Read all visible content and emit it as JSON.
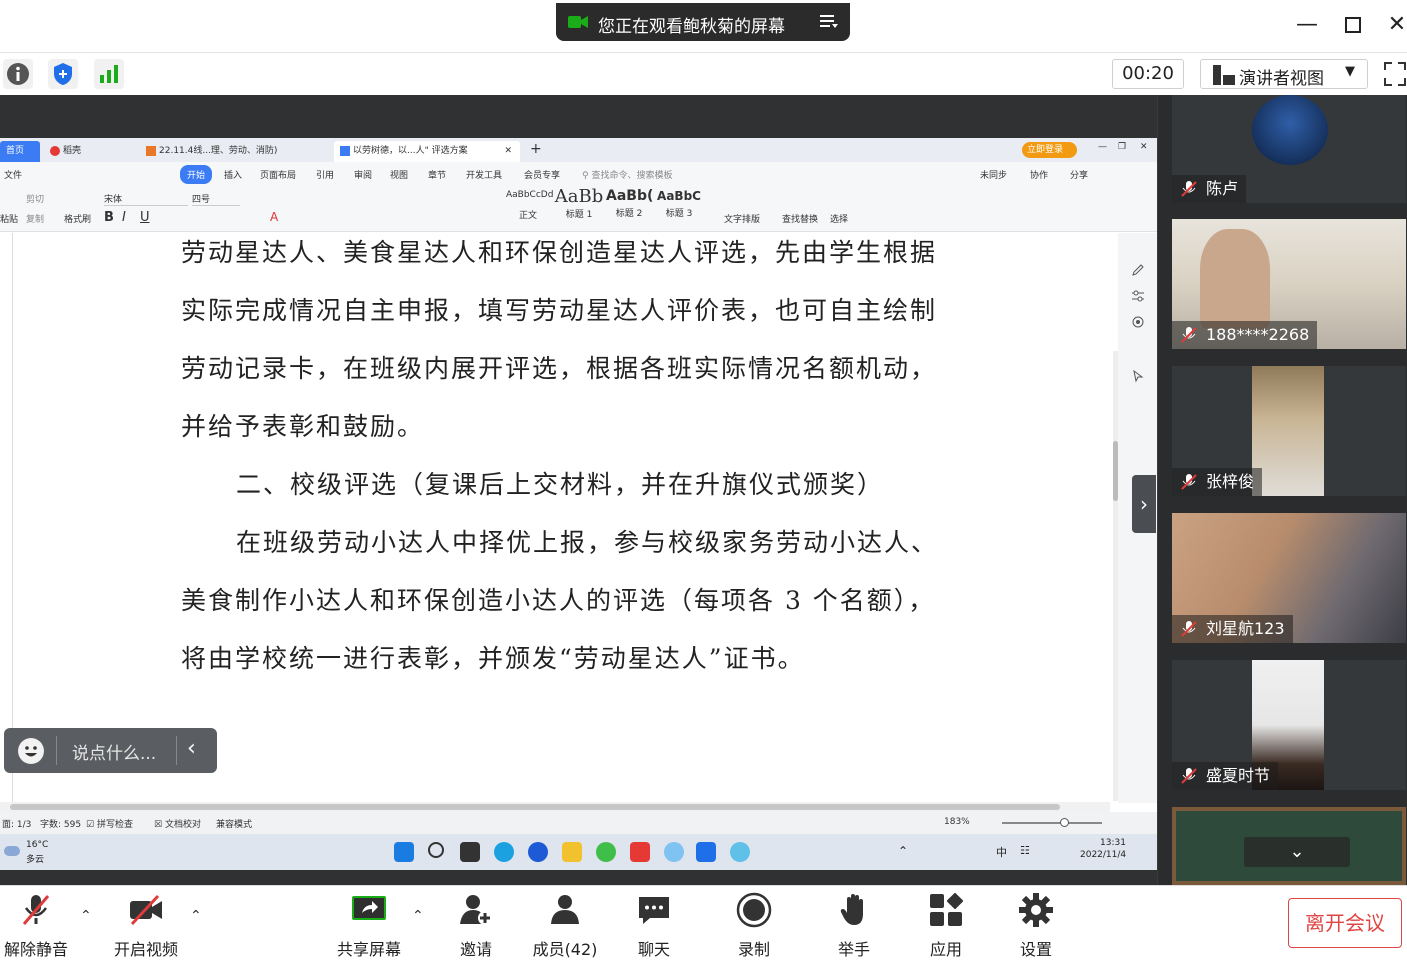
{
  "banner": {
    "text": "您正在观看鲍秋菊的屏幕"
  },
  "toolbar": {
    "timer": "00:20",
    "presenter_view": "演讲者视图"
  },
  "wps": {
    "tabs": [
      "首页",
      "稻壳",
      "22.11.4线...理、劳动、消防)",
      "以劳树德，以...人\" 评选方案"
    ],
    "login": "立即登录",
    "menus": [
      "文件",
      "开始",
      "插入",
      "页面布局",
      "引用",
      "审阅",
      "视图",
      "章节",
      "开发工具",
      "会员专享"
    ],
    "search_placeholder": "查找命令、搜索模板",
    "right_menus": [
      "未同步",
      "协作",
      "分享"
    ],
    "ribbon": {
      "paste": "粘贴",
      "cut": "剪切",
      "copy": "复制",
      "format_painter": "格式刷",
      "font": "宋体",
      "size": "四号",
      "styles": [
        {
          "preview": "AaBbCcDd",
          "name": "正文"
        },
        {
          "preview": "AaBb",
          "name": "标题 1"
        },
        {
          "preview": "AaBb(",
          "name": "标题 2"
        },
        {
          "preview": "AaBbC",
          "name": "标题 3"
        }
      ],
      "text_layout": "文字排版",
      "find_replace": "查找替换",
      "select": "选择"
    },
    "status": {
      "page": "面: 1/3",
      "words": "字数: 595",
      "spell": "拼写检查",
      "proof": "文档校对",
      "compat": "兼容模式",
      "zoom": "183%"
    }
  },
  "document": {
    "lines": [
      "劳动星达人、美食星达人和环保创造星达人评选，先由学生根据",
      "实际完成情况自主申报，填写劳动星达人评价表，也可自主绘制",
      "劳动记录卡，在班级内展开评选，根据各班实际情况名额机动，",
      "并给予表彰和鼓励。",
      "二、校级评选（复课后上交材料，并在升旗仪式颁奖）",
      "在班级劳动小达人中择优上报，参与校级家务劳动小达人、",
      "美食制作小达人和环保创造小达人的评选（每项各 3 个名额），",
      "将由学校统一进行表彰，并颁发“劳动星达人”证书。"
    ]
  },
  "taskbar": {
    "weather_temp": "16°C",
    "weather_desc": "多云",
    "ime": "中",
    "time": "13:31",
    "date": "2022/11/4"
  },
  "chat": {
    "placeholder": "说点什么..."
  },
  "participants": [
    {
      "name": "陈卢"
    },
    {
      "name": "188****2268"
    },
    {
      "name": "张梓俊"
    },
    {
      "name": "刘星航123"
    },
    {
      "name": "盛夏时节"
    }
  ],
  "bottom": {
    "unmute": "解除静音",
    "start_video": "开启视频",
    "share": "共享屏幕",
    "invite": "邀请",
    "members": "成员(42)",
    "chat": "聊天",
    "record": "录制",
    "raise_hand": "举手",
    "apps": "应用",
    "settings": "设置",
    "leave": "离开会议"
  },
  "colors": {
    "accent": "#1aad19",
    "leave": "#e04545",
    "wps_blue": "#3b7cf4"
  }
}
